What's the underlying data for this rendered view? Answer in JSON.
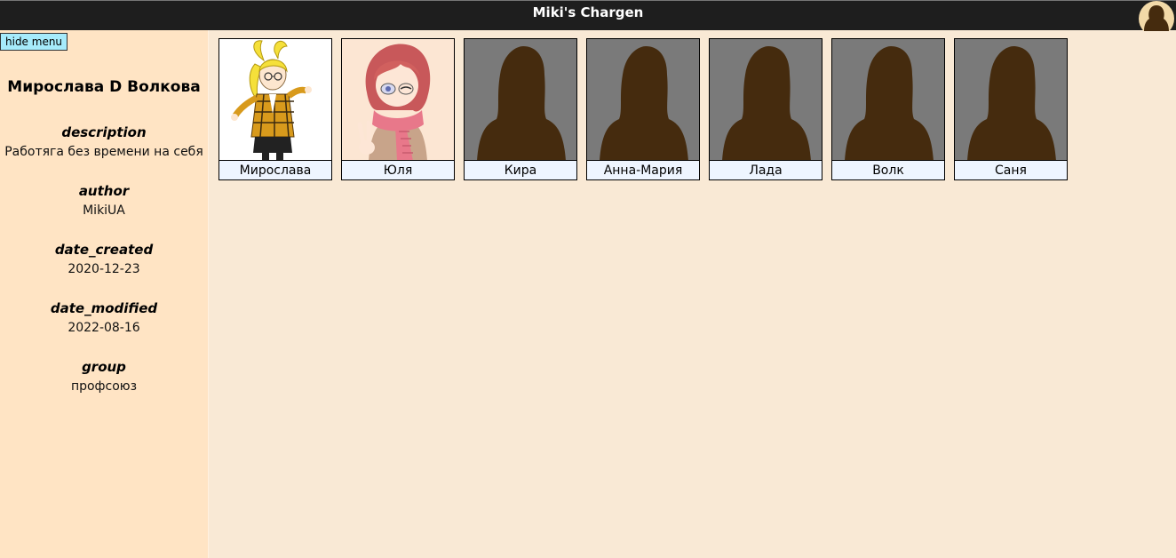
{
  "app": {
    "title": "Miki's Chargen"
  },
  "sidebar": {
    "hide_button": "hide menu",
    "character_name": "Мирослава D Волкова",
    "fields": [
      {
        "key": "description",
        "value": "Работяга без времени на себя"
      },
      {
        "key": "author",
        "value": "MikiUA"
      },
      {
        "key": "date_created",
        "value": "2020-12-23"
      },
      {
        "key": "date_modified",
        "value": "2022-08-16"
      },
      {
        "key": "group",
        "value": "профсоюз"
      }
    ]
  },
  "characters": [
    {
      "name": "Мирослава",
      "icon": "anime-girl-blonde-plaid-icon"
    },
    {
      "name": "Юля",
      "icon": "anime-girl-pink-scarf-icon"
    },
    {
      "name": "Кира",
      "icon": "silhouette-placeholder-icon"
    },
    {
      "name": "Анна-Мария",
      "icon": "silhouette-placeholder-icon"
    },
    {
      "name": "Лада",
      "icon": "silhouette-placeholder-icon"
    },
    {
      "name": "Волк",
      "icon": "silhouette-placeholder-icon"
    },
    {
      "name": "Саня",
      "icon": "silhouette-placeholder-icon"
    }
  ],
  "colors": {
    "topbar_bg": "#1e1e1e",
    "sidebar_bg": "#ffe4c4",
    "main_bg": "#f9e9d5",
    "button_bg": "#a6ebfb",
    "card_label_bg": "#eef5ff",
    "silhouette": "#452b0e",
    "silhouette_bg": "#7a7a7a"
  }
}
